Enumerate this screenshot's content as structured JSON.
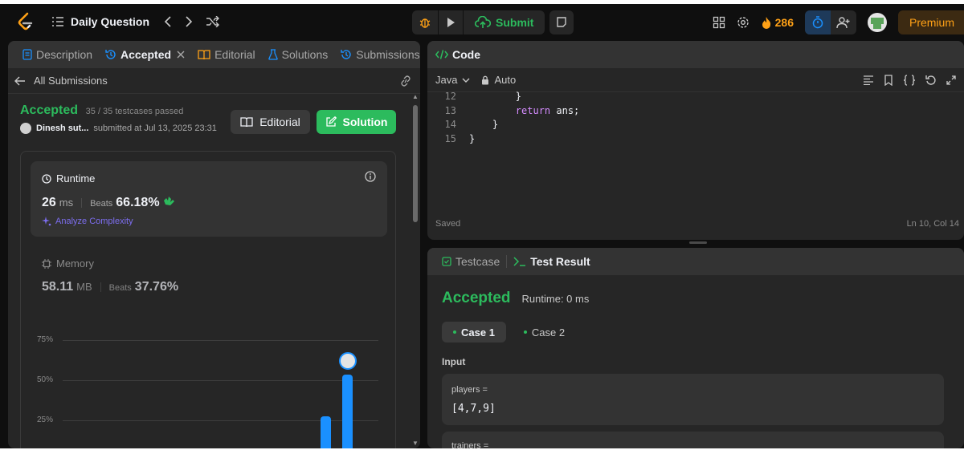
{
  "nav": {
    "title": "Daily Question",
    "submit_label": "Submit",
    "streak": "286",
    "premium_label": "Premium"
  },
  "left_panel": {
    "tabs": [
      {
        "label": "Description",
        "icon": "file-text-icon"
      },
      {
        "label": "Accepted",
        "icon": "history-icon",
        "active": true,
        "closable": true
      },
      {
        "label": "Editorial",
        "icon": "book-icon"
      },
      {
        "label": "Solutions",
        "icon": "flask-icon"
      },
      {
        "label": "Submissions",
        "icon": "history-icon"
      }
    ],
    "back_label": "All Submissions",
    "status": "Accepted",
    "testcases": "35 / 35 testcases passed",
    "username": "Dinesh sut...",
    "submitted": "submitted at Jul 13, 2025 23:31",
    "editorial_btn": "Editorial",
    "solution_btn": "Solution",
    "runtime": {
      "label": "Runtime",
      "value": "26",
      "unit": "ms",
      "beats_label": "Beats",
      "beats": "66.18%",
      "analyze": "Analyze Complexity"
    },
    "memory": {
      "label": "Memory",
      "value": "58.11",
      "unit": "MB",
      "beats_label": "Beats",
      "beats": "37.76%"
    },
    "chart_data": {
      "type": "bar",
      "yticks": [
        "75%",
        "50%",
        "25%"
      ],
      "ylim": [
        0,
        75
      ],
      "values": [
        27.5,
        53.5,
        0.5
      ],
      "highlight_index": 1,
      "grid": true
    }
  },
  "code_panel": {
    "title": "Code",
    "language": "Java",
    "mode": "Auto",
    "lines": [
      {
        "n": "12",
        "text": "        }"
      },
      {
        "n": "13",
        "text": "        ",
        "kw": "return",
        "rest": " ans;"
      },
      {
        "n": "14",
        "text": "    }"
      },
      {
        "n": "15",
        "text": "}"
      }
    ],
    "saved": "Saved",
    "cursor": "Ln 10, Col 14"
  },
  "test_panel": {
    "tab_testcase": "Testcase",
    "tab_result": "Test Result",
    "status": "Accepted",
    "runtime": "Runtime: 0 ms",
    "cases": [
      "Case 1",
      "Case 2"
    ],
    "input_label": "Input",
    "var1_name": "players =",
    "var1_value": "[4,7,9]",
    "var2_name": "trainers ="
  },
  "colors": {
    "accent_green": "#2cbb5d",
    "accent_orange": "#ffa116",
    "bar_blue": "#1a90ff",
    "panel_bg": "#262626"
  }
}
